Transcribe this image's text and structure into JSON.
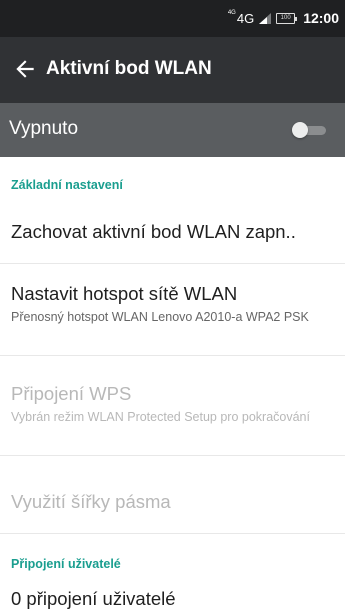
{
  "status_bar": {
    "network_small": "4G",
    "network": "4G",
    "signal_icon": "signal-icon",
    "battery": "100",
    "time": "12:00"
  },
  "toolbar": {
    "back_icon": "arrow-left-icon",
    "title": "Aktivní bod WLAN"
  },
  "master_switch": {
    "label": "Vypnuto",
    "state": "off"
  },
  "sections": {
    "basic_header": "Základní nastavení",
    "keep_on_title": "Zachovat aktivní bod WLAN zapn..",
    "setup_title": "Nastavit hotspot sítě WLAN",
    "setup_summary": "Přenosný hotspot WLAN Lenovo A2010-a WPA2 PSK",
    "wps_title": "Připojení WPS",
    "wps_summary": "Vybrán režim WLAN Protected Setup pro pokračování",
    "bandwidth_title": "Využití šířky pásma",
    "users_header": "Připojení uživatelé",
    "users_title": "0 připojení uživatelé"
  },
  "colors": {
    "accent": "#1a9e8f",
    "toolbar": "#303235",
    "status_bar": "#1f2022",
    "switch_bar": "#5a5d60"
  }
}
